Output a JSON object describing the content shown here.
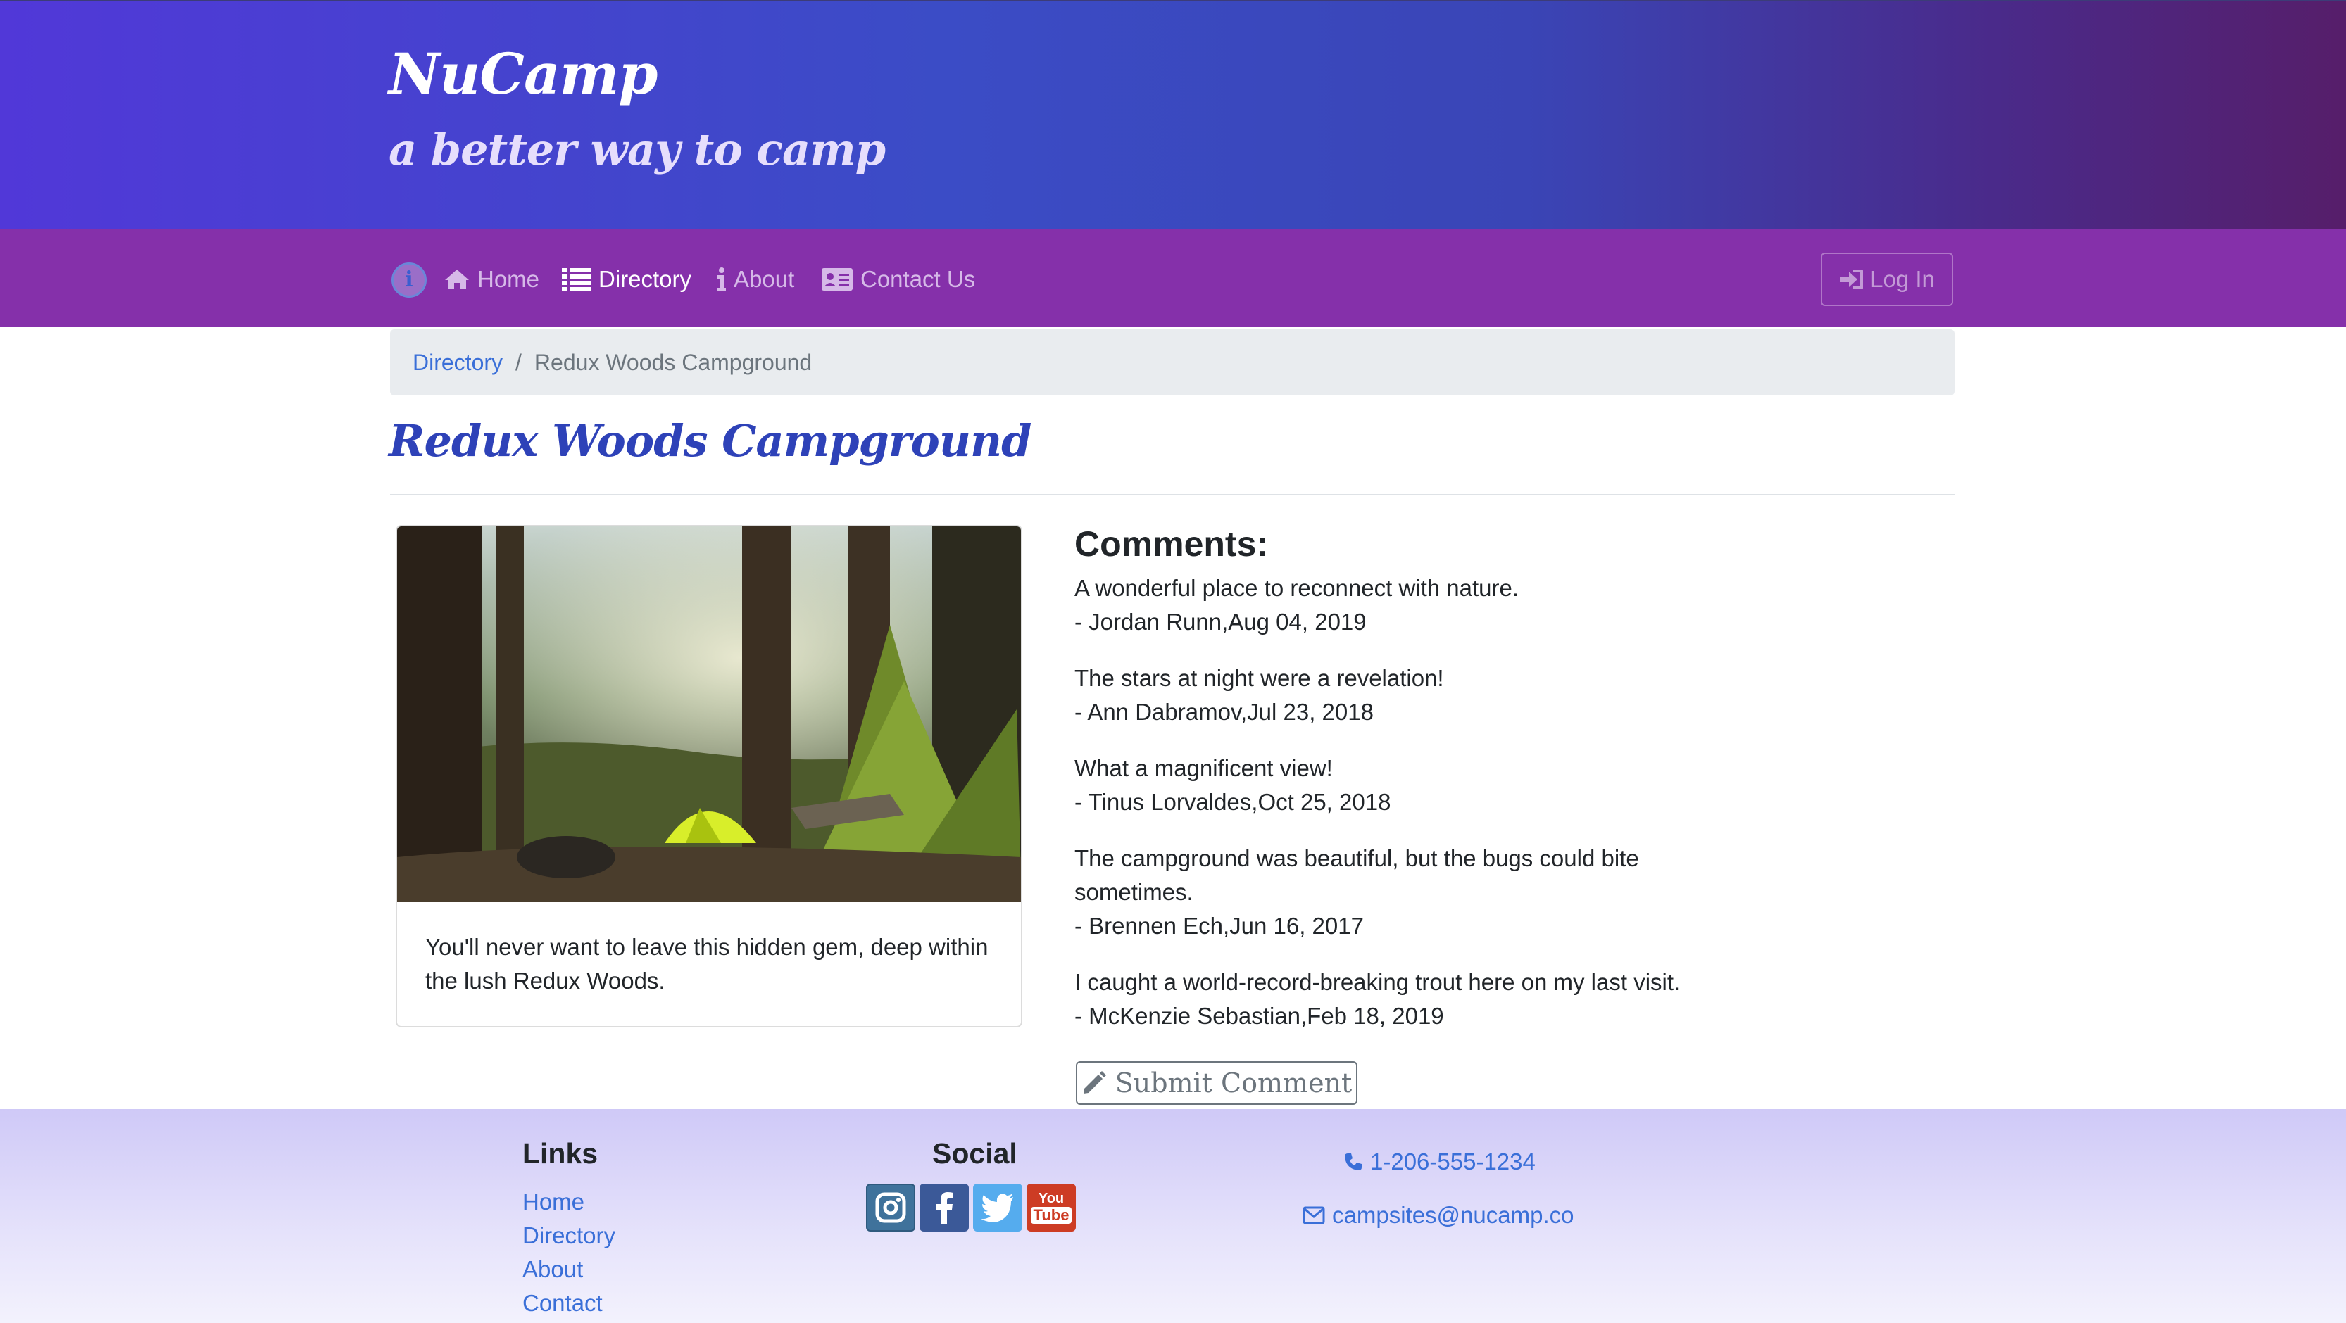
{
  "header": {
    "brand": "NuCamp",
    "tagline": "a better way to camp"
  },
  "navbar": {
    "items": [
      {
        "label": "Home",
        "icon": "home-icon",
        "active": false
      },
      {
        "label": "Directory",
        "icon": "list-icon",
        "active": true
      },
      {
        "label": "About",
        "icon": "info-icon",
        "active": false
      },
      {
        "label": "Contact Us",
        "icon": "address-card-icon",
        "active": false
      }
    ],
    "login_label": "Log In"
  },
  "breadcrumb": {
    "link": "Directory",
    "separator": "/",
    "current": "Redux Woods Campground"
  },
  "campsite": {
    "name": "Redux Woods Campground",
    "description": "You'll never want to leave this hidden gem, deep within the lush Redux Woods."
  },
  "comments": {
    "heading": "Comments:",
    "items": [
      {
        "text": "A wonderful place to reconnect with nature.",
        "byline": "- Jordan Runn,Aug 04, 2019"
      },
      {
        "text": "The stars at night were a revelation!",
        "byline": "- Ann Dabramov,Jul 23, 2018"
      },
      {
        "text": "What a magnificent view!",
        "byline": "- Tinus Lorvaldes,Oct 25, 2018"
      },
      {
        "text": "The campground was beautiful, but the bugs could bite sometimes.",
        "byline": "- Brennen Ech,Jun 16, 2017"
      },
      {
        "text": "I caught a world-record-breaking trout here on my last visit.",
        "byline": "- McKenzie Sebastian,Feb 18, 2019"
      }
    ],
    "submit_label": "Submit Comment"
  },
  "footer": {
    "links_title": "Links",
    "links": [
      "Home",
      "Directory",
      "About",
      "Contact"
    ],
    "social_title": "Social",
    "social": [
      {
        "name": "instagram-icon",
        "color": "#3f729b"
      },
      {
        "name": "facebook-icon",
        "color": "#3b5998"
      },
      {
        "name": "twitter-icon",
        "color": "#55acee"
      },
      {
        "name": "youtube-icon",
        "color": "#cd3c24",
        "top": "You",
        "bottom": "Tube"
      }
    ],
    "phone": "1-206-555-1234",
    "email": "campsites@nucamp.co"
  },
  "colors": {
    "navbar": "#8530aa",
    "link": "#3a6fd8",
    "title": "#2e42b8"
  }
}
